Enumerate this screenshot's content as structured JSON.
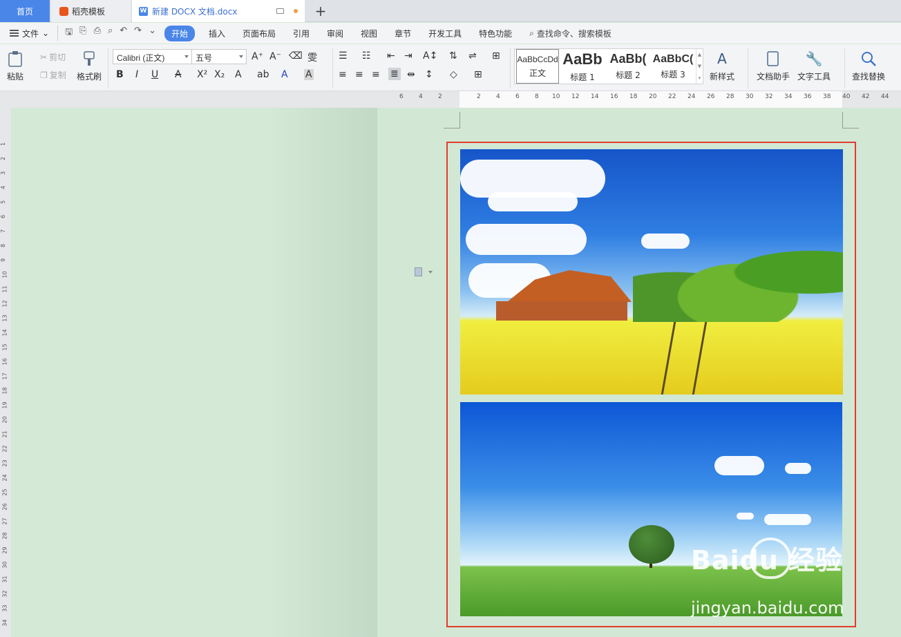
{
  "tabs": {
    "home": "首页",
    "docer": "稻壳模板",
    "document": "新建 DOCX 文档.docx",
    "add": "+"
  },
  "menu": {
    "file": "文件",
    "items": [
      "开始",
      "插入",
      "页面布局",
      "引用",
      "审阅",
      "视图",
      "章节",
      "开发工具",
      "特色功能"
    ],
    "search": "查找命令、搜索模板"
  },
  "ribbon": {
    "paste": "粘贴",
    "cut": "剪切",
    "copy": "复制",
    "format_painter": "格式刷",
    "font_name": "Calibri (正文)",
    "font_size": "五号",
    "styles": [
      {
        "sample": "AaBbCcDd",
        "label": "正文"
      },
      {
        "sample": "AaBb",
        "label": "标题 1"
      },
      {
        "sample": "AaBb(",
        "label": "标题 2"
      },
      {
        "sample": "AaBbC(",
        "label": "标题 3"
      }
    ],
    "new_style": "新样式",
    "doc_assistant": "文档助手",
    "text_tools": "文字工具",
    "find_replace": "查找替换"
  },
  "watermark": {
    "logo": "Baidu 经验",
    "url": "jingyan.baidu.com"
  },
  "colors": {
    "accent": "#4a86e8",
    "selection": "#e23b2e",
    "page_bg": "#d2e8d4"
  }
}
